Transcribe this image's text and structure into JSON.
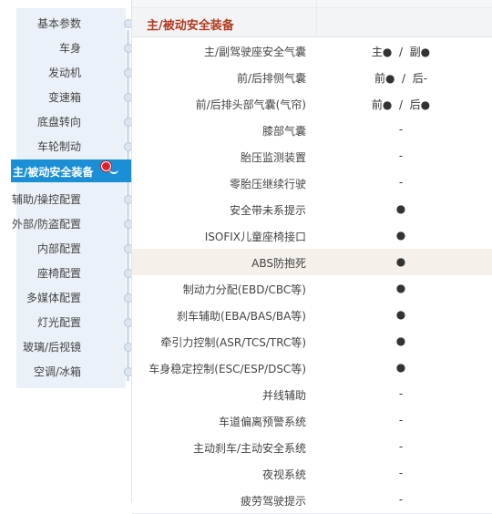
{
  "sidebar": {
    "items": [
      {
        "label": "基本参数"
      },
      {
        "label": "车身"
      },
      {
        "label": "发动机"
      },
      {
        "label": "变速箱"
      },
      {
        "label": "底盘转向"
      },
      {
        "label": "车轮制动"
      },
      {
        "label": "主/被动安全装备"
      },
      {
        "label": "辅助/操控配置"
      },
      {
        "label": "外部/防盗配置"
      },
      {
        "label": "内部配置"
      },
      {
        "label": "座椅配置"
      },
      {
        "label": "多媒体配置"
      },
      {
        "label": "灯光配置"
      },
      {
        "label": "玻璃/后视镜"
      },
      {
        "label": "空调/冰箱"
      }
    ],
    "active_index": 6
  },
  "section": {
    "title": "主/被动安全装备"
  },
  "rows": [
    {
      "label": "主/副驾驶座安全气囊",
      "value": "主●  /  副●"
    },
    {
      "label": "前/后排侧气囊",
      "value": "前●  /  后-"
    },
    {
      "label": "前/后排头部气囊(气帘)",
      "value": "前●  /  后●"
    },
    {
      "label": "膝部气囊",
      "value": "-"
    },
    {
      "label": "胎压监测装置",
      "value": "-"
    },
    {
      "label": "零胎压继续行驶",
      "value": "-"
    },
    {
      "label": "安全带未系提示",
      "value": "●"
    },
    {
      "label": "ISOFIX儿童座椅接口",
      "value": "●"
    },
    {
      "label": "ABS防抱死",
      "value": "●"
    },
    {
      "label": "制动力分配(EBD/CBC等)",
      "value": "●"
    },
    {
      "label": "刹车辅助(EBA/BAS/BA等)",
      "value": "●"
    },
    {
      "label": "牵引力控制(ASR/TCS/TRC等)",
      "value": "●"
    },
    {
      "label": "车身稳定控制(ESC/ESP/DSC等)",
      "value": "●"
    },
    {
      "label": "并线辅助",
      "value": "-"
    },
    {
      "label": "车道偏离预警系统",
      "value": "-"
    },
    {
      "label": "主动刹车/主动安全系统",
      "value": "-"
    },
    {
      "label": "夜视系统",
      "value": "-"
    },
    {
      "label": "疲劳驾驶提示",
      "value": "-"
    }
  ],
  "highlight_row_index": 8,
  "colors": {
    "accent": "#1b8fd6",
    "section_title": "#b23a1f",
    "pin": "#d9232e"
  },
  "icons": {
    "active_marker": "map-pin-icon",
    "nav_dot": "timeline-dot-icon"
  }
}
